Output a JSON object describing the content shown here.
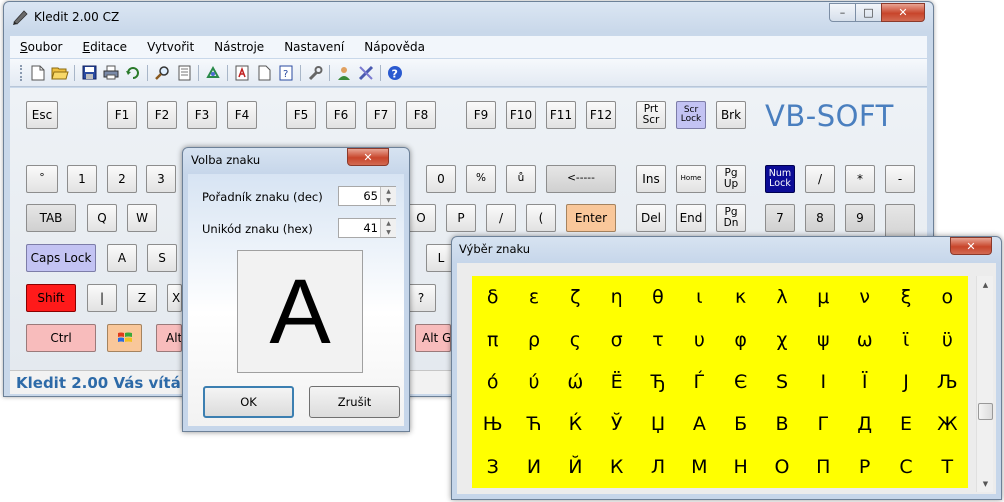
{
  "main_window": {
    "title": "Kledit 2.00 CZ",
    "caption_buttons": {
      "minimize": "–",
      "maximize": "□",
      "close": "✕"
    },
    "menu": [
      {
        "label": "Soubor",
        "underline": "S",
        "rest": "oubor"
      },
      {
        "label": "Editace",
        "underline": "E",
        "rest": "ditace"
      },
      {
        "label": "Vytvořit",
        "underline": "",
        "rest": "Vytvořit"
      },
      {
        "label": "Nástroje",
        "underline": "",
        "rest": "Nástroje"
      },
      {
        "label": "Nastavení",
        "underline": "",
        "rest": "Nastavení"
      },
      {
        "label": "Nápověda",
        "underline": "",
        "rest": "Nápověda"
      }
    ],
    "toolbar_icons": [
      "new-file-icon",
      "open-folder-icon",
      "save-icon",
      "print-icon",
      "refresh-icon",
      "find-icon",
      "document-icon",
      "recycle-icon",
      "text-a-icon",
      "page-icon",
      "help-page-icon",
      "wrench-icon",
      "user-icon",
      "tools-icon",
      "help-icon"
    ],
    "brand": "VB-SOFT",
    "status": "Kledit 2.00 Vás vítá"
  },
  "keys": {
    "esc": "Esc",
    "f1": "F1",
    "f2": "F2",
    "f3": "F3",
    "f4": "F4",
    "f5": "F5",
    "f6": "F6",
    "f7": "F7",
    "f8": "F8",
    "f9": "F9",
    "f10": "F10",
    "f11": "F11",
    "f12": "F12",
    "prtscr": "Prt\nScr",
    "scrlock": "Scr\nLock",
    "brk": "Brk",
    "degree": "°",
    "k1": "1",
    "k2": "2",
    "k3": "3",
    "k0": "0",
    "percent": "%",
    "uring": "ů",
    "backspace": "<-----",
    "ins": "Ins",
    "home": "Home",
    "pgup": "Pg\nUp",
    "numlock": "Num\nLock",
    "div": "/",
    "mul": "*",
    "minus": "-",
    "tab": "TAB",
    "q": "Q",
    "w": "W",
    "o": "O",
    "p": "P",
    "slash": "/",
    "paren": "(",
    "enter": "Enter",
    "del": "Del",
    "end": "End",
    "pgdn": "Pg\nDn",
    "n7": "7",
    "n8": "8",
    "n9": "9",
    "capslock": "Caps Lock",
    "a": "A",
    "s": "S",
    "l": "L",
    "shift": "Shift",
    "pipe": "|",
    "z": "Z",
    "x": "X",
    "question": "?",
    "colon": ":",
    "ctrl": "Ctrl",
    "win": "win-logo",
    "alt": "Alt",
    "altgr": "Alt Gr"
  },
  "dialog": {
    "title": "Volba znaku",
    "close": "✕",
    "ordinal_label": "Pořadník znaku (dec)",
    "ordinal_value": "65",
    "unicode_label": "Unikód znaku (hex)",
    "unicode_value": "41",
    "preview_char": "A",
    "ok": "OK",
    "cancel": "Zrušit"
  },
  "picker": {
    "title": "Výběr znaku",
    "close": "✕",
    "rows": [
      [
        "δ",
        "ε",
        "ζ",
        "η",
        "θ",
        "ι",
        "κ",
        "λ",
        "μ",
        "ν",
        "ξ",
        "ο"
      ],
      [
        "π",
        "ρ",
        "ς",
        "σ",
        "τ",
        "υ",
        "φ",
        "χ",
        "ψ",
        "ω",
        "ϊ",
        "ϋ"
      ],
      [
        "ό",
        "ύ",
        "ώ",
        "Ё",
        "Ђ",
        "Ѓ",
        "Є",
        "Ѕ",
        "І",
        "Ї",
        "Ј",
        "Љ"
      ],
      [
        "Њ",
        "Ћ",
        "Ќ",
        "Ў",
        "Џ",
        "А",
        "Б",
        "В",
        "Г",
        "Д",
        "Е",
        "Ж"
      ],
      [
        "З",
        "И",
        "Й",
        "К",
        "Л",
        "М",
        "Н",
        "О",
        "П",
        "Р",
        "С",
        "Т"
      ]
    ],
    "grid_color": "#ffff00"
  }
}
